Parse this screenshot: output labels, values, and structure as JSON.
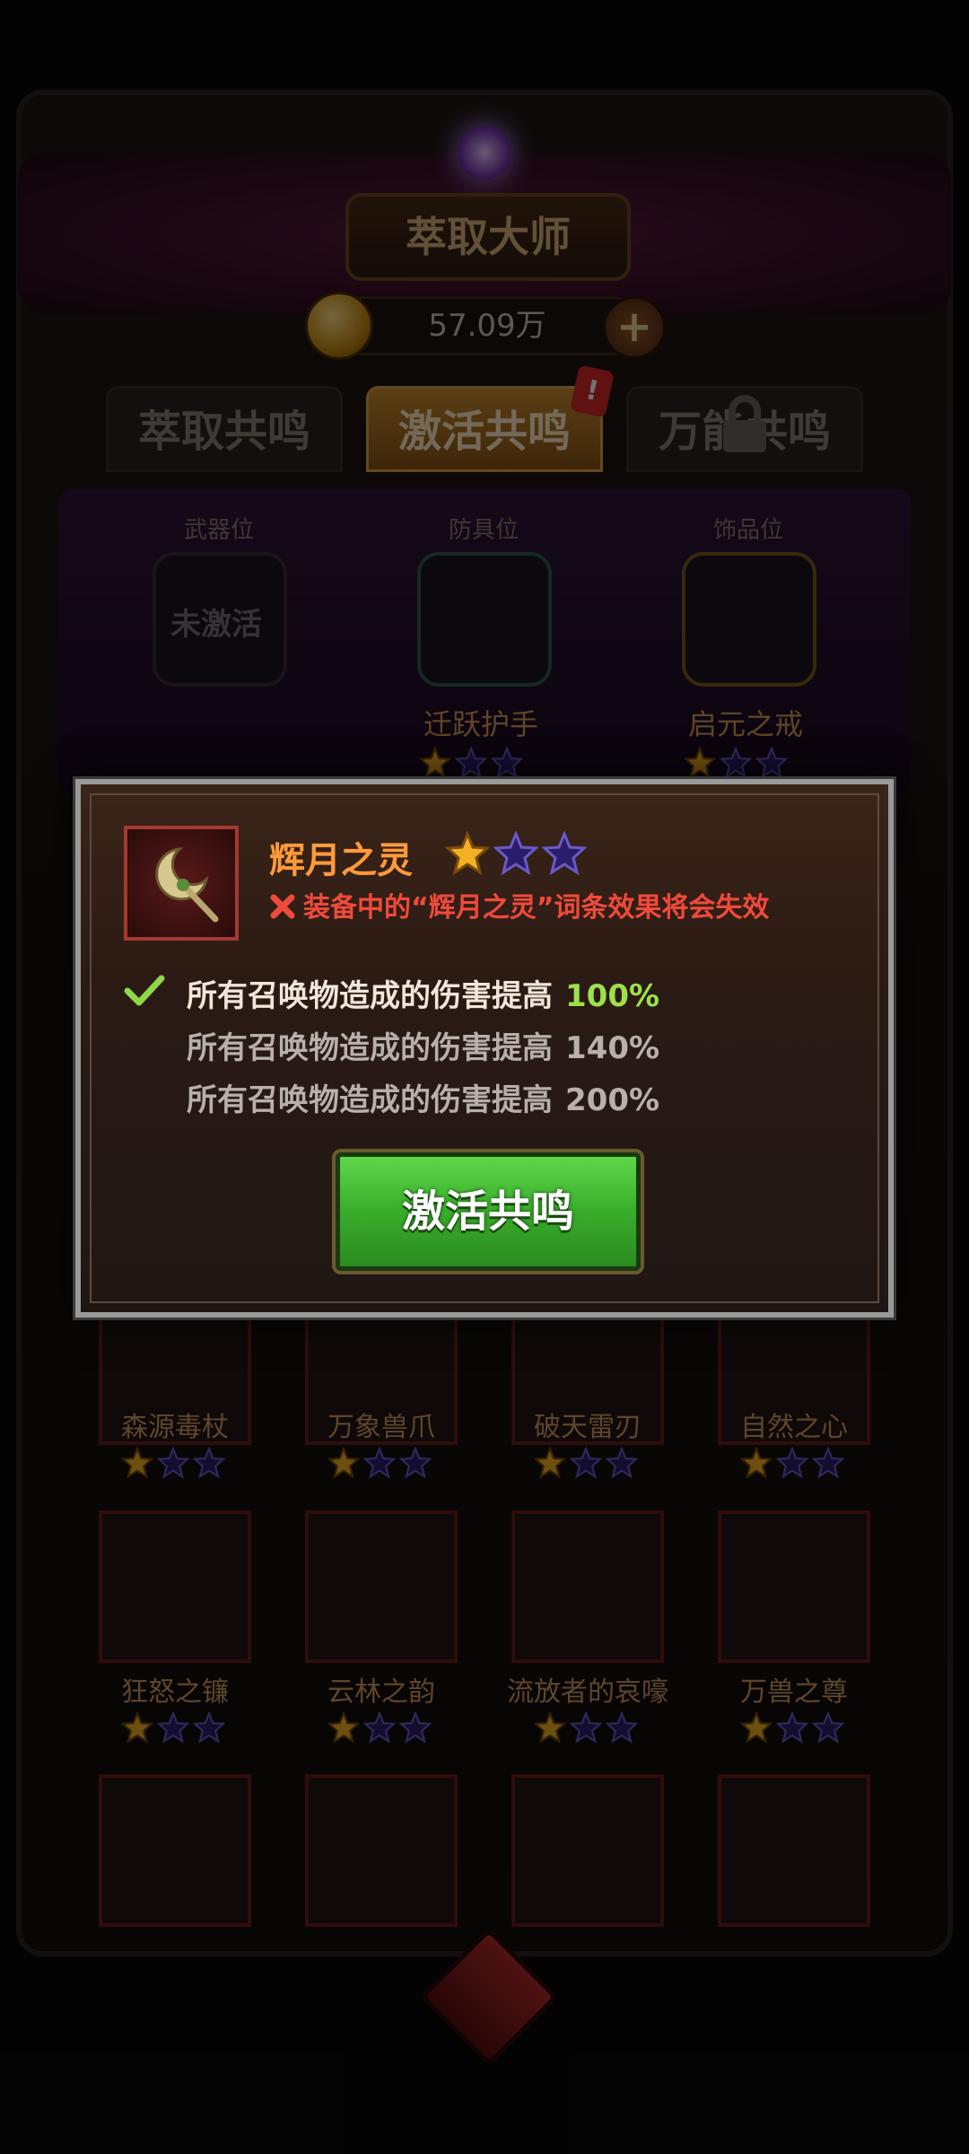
{
  "header": {
    "title": "萃取大师",
    "currency_amount": "57.09万"
  },
  "tabs": [
    {
      "label": "萃取共鸣",
      "active": false
    },
    {
      "label": "激活共鸣",
      "active": true
    },
    {
      "label": "万能共鸣",
      "active": false,
      "locked": true
    }
  ],
  "slots": [
    {
      "header": "武器位",
      "state": "未激活",
      "name": ""
    },
    {
      "header": "防具位",
      "name": "迁跃护手",
      "stars": 1
    },
    {
      "header": "饰品位",
      "name": "启元之戒",
      "stars": 1
    }
  ],
  "grid": [
    {
      "name": "森源毒杖",
      "stars": 1
    },
    {
      "name": "万象兽爪",
      "stars": 1
    },
    {
      "name": "破天雷刃",
      "stars": 1
    },
    {
      "name": "自然之心",
      "stars": 1
    },
    {
      "name": "狂怒之镰",
      "stars": 1
    },
    {
      "name": "云林之韵",
      "stars": 1
    },
    {
      "name": "流放者的哀嚎",
      "stars": 1
    },
    {
      "name": "万兽之尊",
      "stars": 1
    }
  ],
  "modal": {
    "item_name": "辉月之灵",
    "stars_filled": 1,
    "stars_total": 3,
    "warning": "装备中的“辉月之灵”词条效果将会失效",
    "effects": [
      {
        "text": "所有召唤物造成的伤害提高",
        "value": "100%",
        "active": true
      },
      {
        "text": "所有召唤物造成的伤害提高",
        "value": "140%",
        "active": false
      },
      {
        "text": "所有召唤物造成的伤害提高",
        "value": "200%",
        "active": false
      }
    ],
    "button_label": "激活共鸣"
  },
  "colors": {
    "accent_orange": "#ff9a3a",
    "warning_red": "#f04a3a",
    "active_green": "#9ee04a",
    "button_green": "#39ad2b"
  }
}
